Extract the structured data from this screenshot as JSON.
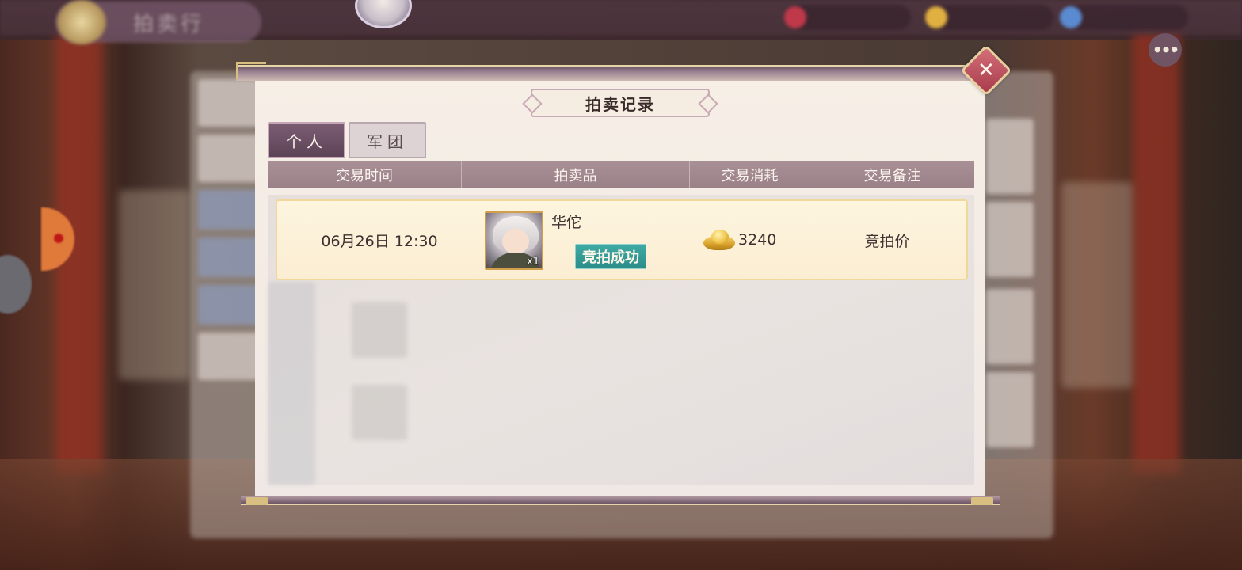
{
  "background": {
    "title": "拍卖行"
  },
  "dialog": {
    "title": "拍卖记录",
    "close_icon": "close-x",
    "tabs": [
      {
        "label": "个人",
        "active": true
      },
      {
        "label": "军团",
        "active": false
      }
    ],
    "columns": [
      "交易时间",
      "拍卖品",
      "交易消耗",
      "交易备注"
    ],
    "records": [
      {
        "time": "06月26日 12:30",
        "item_name": "华佗",
        "item_icon": "hero-portrait",
        "item_qty": "x1",
        "status": "竞拍成功",
        "currency_icon": "gold-ingot-icon",
        "cost": "3240",
        "note": "竞拍价"
      }
    ]
  },
  "colors": {
    "tab_active": "#6a4f64",
    "header_bg": "#a48c92",
    "record_bg": "#fcf1d8",
    "status_bg": "#35a09b",
    "close_bg": "#b94a5a"
  }
}
